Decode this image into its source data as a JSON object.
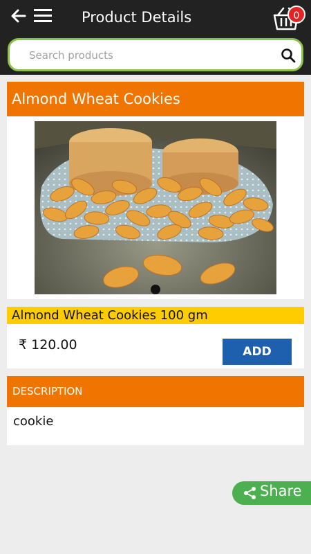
{
  "header": {
    "title": "Product Details",
    "back_icon": "arrow-left-icon",
    "menu_icon": "hamburger-menu-icon",
    "cart_icon": "shopping-basket-icon",
    "cart_count": "0"
  },
  "search": {
    "placeholder": "Search products",
    "value": "",
    "icon": "search-icon"
  },
  "product": {
    "name": "Almond Wheat Cookies",
    "variant": "Almond Wheat Cookies 100 gm",
    "price": "₹ 120.00",
    "add_label": "ADD",
    "image_icon": "product-photo-cookies-almonds",
    "carousel_index": 1,
    "carousel_total": 1
  },
  "description": {
    "heading": "DESCRIPTION",
    "text": "cookie"
  },
  "share": {
    "label": "Share",
    "icon": "share-icon"
  },
  "colors": {
    "topbar": "#222222",
    "accent_orange": "#ef7500",
    "variant_yellow": "#ffcc00",
    "add_button_blue": "#1e5fae",
    "search_border_green": "#8bc34a",
    "share_green": "#4caf50",
    "badge_red": "#e32424"
  }
}
